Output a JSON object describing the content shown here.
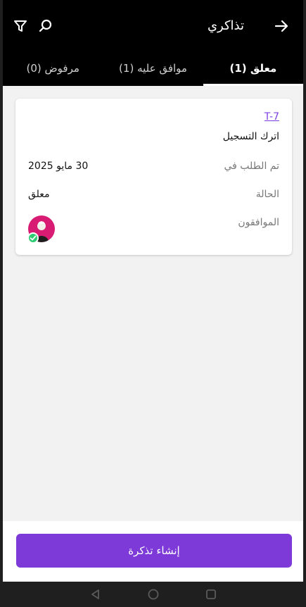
{
  "header": {
    "title": "تذاكري",
    "icons": {
      "back": "arrow-right-icon",
      "search": "search-icon",
      "filter": "filter-icon"
    }
  },
  "tabs": [
    {
      "label": "معلق (1)",
      "active": true
    },
    {
      "label": "موافق عليه (1)",
      "active": false
    },
    {
      "label": "مرفوض (0)",
      "active": false
    }
  ],
  "ticket": {
    "id": "T-7",
    "subject": "اترك التسجيل",
    "requested_label": "تم الطلب في",
    "requested_value": "30 مايو 2025",
    "status_label": "الحالة",
    "status_value": "معلق",
    "approvers_label": "الموافقون"
  },
  "footer": {
    "create_button": "إنشاء تذكرة"
  },
  "system_nav": {
    "icons": [
      "back-triangle-icon",
      "home-circle-icon",
      "recents-square-icon"
    ]
  },
  "colors": {
    "accent": "#7d3ad8",
    "avatar": "#d81b73",
    "verified": "#2ecc71"
  }
}
